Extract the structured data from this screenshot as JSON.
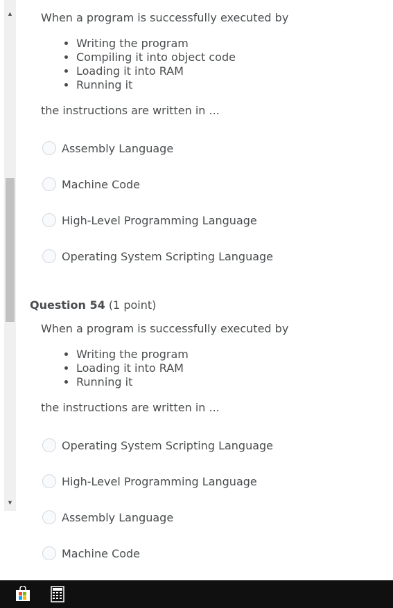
{
  "question_prev": {
    "stem": "When a program is successfully executed by",
    "steps": [
      "Writing the program",
      "Compiling it into object code",
      "Loading it into RAM",
      "Running it"
    ],
    "prompt": "the instructions are written in ...",
    "options": [
      "Assembly Language",
      "Machine Code",
      "High-Level Programming Language",
      "Operating System Scripting Language"
    ]
  },
  "question_54": {
    "number": "Question 54",
    "points": "(1 point)",
    "stem": "When a program is successfully executed by",
    "steps": [
      "Writing the program",
      "Loading it into RAM",
      "Running it"
    ],
    "prompt": "the instructions are written in ...",
    "options": [
      "Operating System Scripting Language",
      "High-Level Programming Language",
      "Assembly Language",
      "Machine Code"
    ]
  },
  "taskbar": {
    "icons": [
      "store-icon",
      "calculator-icon"
    ]
  }
}
